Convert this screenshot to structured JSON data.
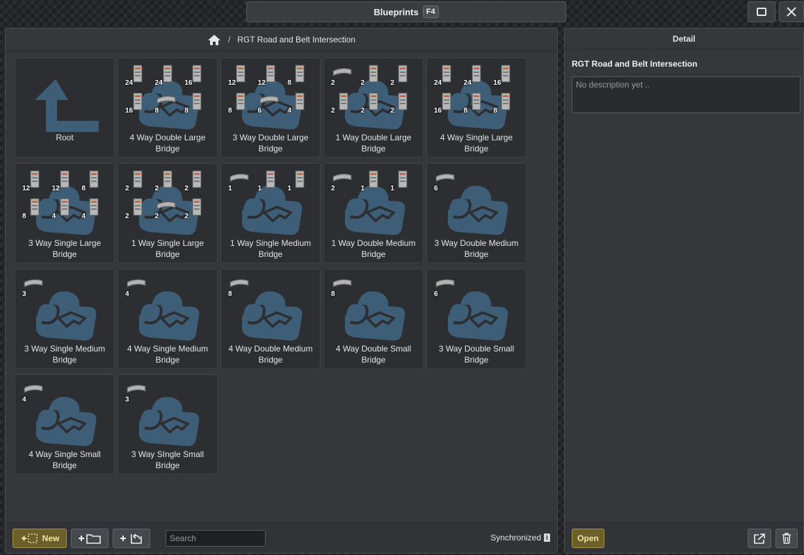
{
  "window": {
    "title": "Blueprints",
    "shortcut": "F4",
    "maximize_icon": "maximize-icon",
    "close_icon": "close-icon"
  },
  "breadcrumb": {
    "home_icon": "home-icon",
    "separator": "/",
    "current": "RGT Road and Belt Intersection"
  },
  "colors": {
    "blueprint_blue": "#3e5e78",
    "accent_yellow": "#a89245",
    "panel_bg": "#35373b"
  },
  "tiles": [
    {
      "label": "Root",
      "kind": "root"
    },
    {
      "label": "4 Way Double Large Bridge",
      "counts": [
        {
          "n": "24",
          "i": "tower"
        },
        {
          "n": "24",
          "i": "tower"
        },
        {
          "n": "16",
          "i": "tower"
        },
        {
          "n": "16",
          "i": "tower"
        },
        {
          "n": "8",
          "i": "road"
        },
        {
          "n": "8",
          "i": "tower"
        }
      ]
    },
    {
      "label": "3 Way Double Large Bridge",
      "counts": [
        {
          "n": "12",
          "i": "tower"
        },
        {
          "n": "12",
          "i": "tower"
        },
        {
          "n": "8",
          "i": "tower"
        },
        {
          "n": "8",
          "i": "tower"
        },
        {
          "n": "6",
          "i": "road"
        },
        {
          "n": "4",
          "i": "tower"
        }
      ]
    },
    {
      "label": "1 Way Double Large Bridge",
      "counts": [
        {
          "n": "2",
          "i": "road"
        },
        {
          "n": "2",
          "i": "tower"
        },
        {
          "n": "2",
          "i": "tower"
        },
        {
          "n": "2",
          "i": "tower"
        },
        {
          "n": "2",
          "i": "tower"
        },
        {
          "n": "2",
          "i": "tower"
        }
      ]
    },
    {
      "label": "4 Way Single Large Bridge",
      "counts": [
        {
          "n": "24",
          "i": "tower"
        },
        {
          "n": "24",
          "i": "tower"
        },
        {
          "n": "16",
          "i": "tower"
        },
        {
          "n": "16",
          "i": "tower"
        },
        {
          "n": "8",
          "i": "tower"
        },
        {
          "n": "8",
          "i": "tower"
        }
      ]
    },
    {
      "label": "3 Way Single Large Bridge",
      "counts": [
        {
          "n": "12",
          "i": "tower"
        },
        {
          "n": "12",
          "i": "tower"
        },
        {
          "n": "8",
          "i": "tower"
        },
        {
          "n": "8",
          "i": "tower"
        },
        {
          "n": "4",
          "i": "tower"
        },
        {
          "n": "4",
          "i": "tower"
        }
      ]
    },
    {
      "label": "1 Way Single Large Bridge",
      "counts": [
        {
          "n": "2",
          "i": "tower"
        },
        {
          "n": "2",
          "i": "tower"
        },
        {
          "n": "2",
          "i": "tower"
        },
        {
          "n": "2",
          "i": "tower"
        },
        {
          "n": "2",
          "i": "road"
        },
        {
          "n": "2",
          "i": "tower"
        }
      ]
    },
    {
      "label": "1 Way Single Medium Bridge",
      "counts": [
        {
          "n": "1",
          "i": "road"
        },
        {
          "n": "1",
          "i": "tower"
        },
        {
          "n": "1",
          "i": "tower"
        }
      ]
    },
    {
      "label": "1 Way Double Medium Bridge",
      "counts": [
        {
          "n": "2",
          "i": "road"
        },
        {
          "n": "1",
          "i": "tower"
        },
        {
          "n": "1",
          "i": "tower"
        }
      ]
    },
    {
      "label": "3 Way Double Medium Bridge",
      "counts": [
        {
          "n": "6",
          "i": "road"
        }
      ]
    },
    {
      "label": "3 Way Single Medium Bridge",
      "counts": [
        {
          "n": "3",
          "i": "road"
        }
      ]
    },
    {
      "label": "4 Way Single Medium Bridge",
      "counts": [
        {
          "n": "4",
          "i": "road"
        }
      ]
    },
    {
      "label": "4 Way Double Medium Bridge",
      "counts": [
        {
          "n": "8",
          "i": "road"
        }
      ]
    },
    {
      "label": "4 Way Double Small Bridge",
      "counts": [
        {
          "n": "8",
          "i": "road"
        }
      ]
    },
    {
      "label": "3 Way Double Small Bridge",
      "counts": [
        {
          "n": "6",
          "i": "road"
        }
      ]
    },
    {
      "label": "4 Way Single Small Bridge",
      "counts": [
        {
          "n": "4",
          "i": "road"
        }
      ]
    },
    {
      "label": "3 Way SIngle Small Bridge",
      "counts": [
        {
          "n": "3",
          "i": "road"
        }
      ]
    }
  ],
  "bottom_bar": {
    "new_label": "New",
    "new_icon": "new-selection-icon",
    "new_folder_icon": "add-folder-icon",
    "import_icon": "add-import-icon",
    "search_placeholder": "Search",
    "sync_label": "Synchronized",
    "sync_info": "i"
  },
  "detail": {
    "header": "Detail",
    "name": "RGT Road and Belt Intersection",
    "description_placeholder": "No description yet ..",
    "open_label": "Open",
    "export_icon": "export-icon",
    "delete_icon": "trash-icon"
  }
}
